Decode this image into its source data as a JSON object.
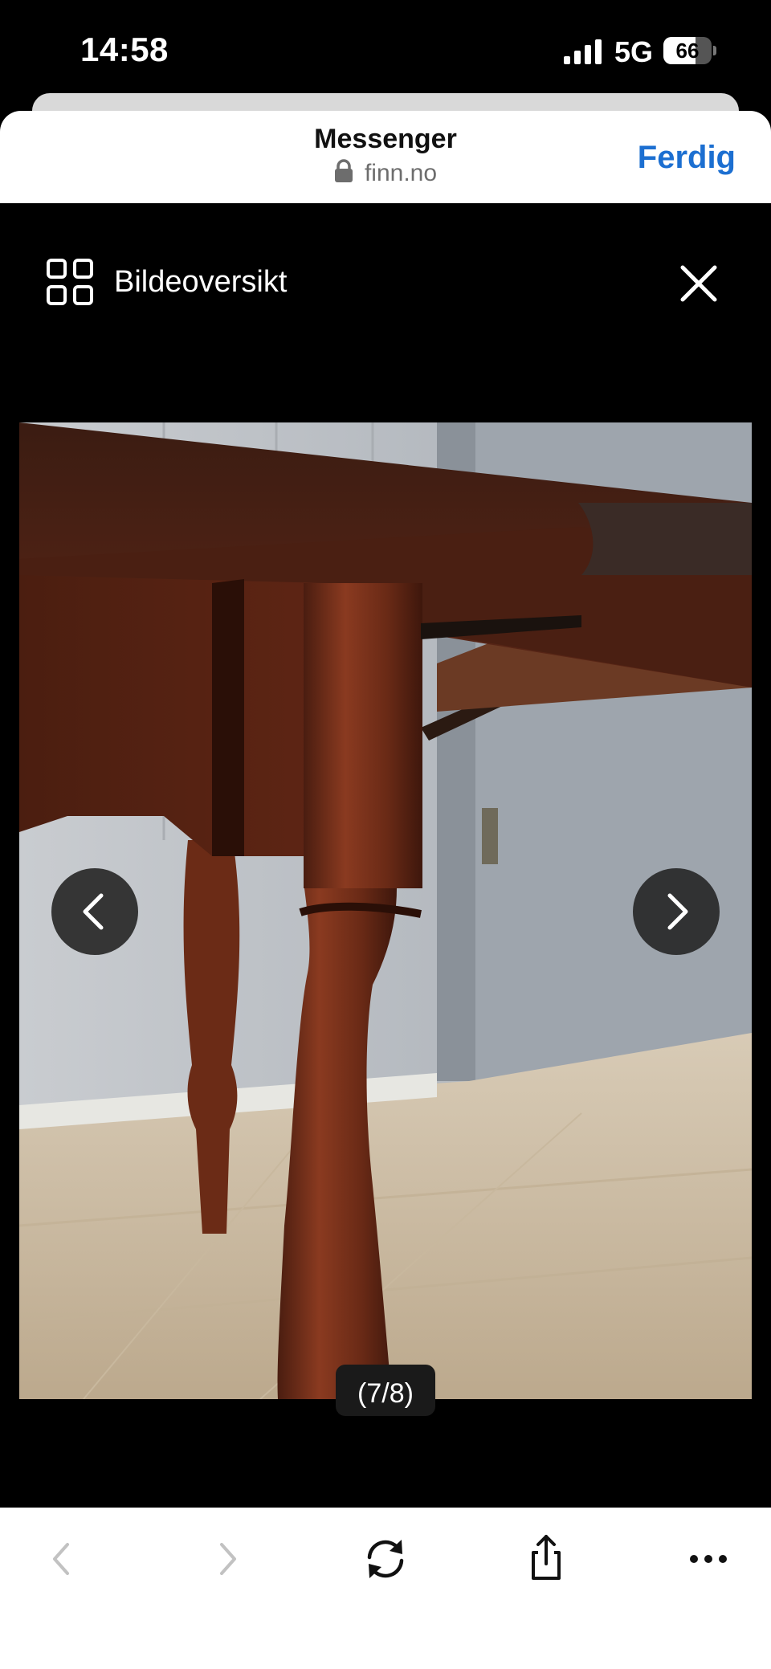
{
  "status_bar": {
    "time": "14:58",
    "network": "5G",
    "battery_level": "66",
    "signal_icon": "cellular-signal-icon"
  },
  "browser": {
    "title": "Messenger",
    "url": "finn.no",
    "done_label": "Ferdig",
    "accent_color": "#1c6fd1"
  },
  "viewer": {
    "overview_label": "Bildeoversikt",
    "counter": "(7/8)",
    "overview_icon": "grid-icon",
    "close_icon": "close-icon",
    "prev_icon": "chevron-left-icon",
    "next_icon": "chevron-right-icon"
  },
  "toolbar": {
    "items": [
      "back-icon",
      "forward-icon",
      "reload-icon",
      "share-icon",
      "more-icon"
    ]
  }
}
